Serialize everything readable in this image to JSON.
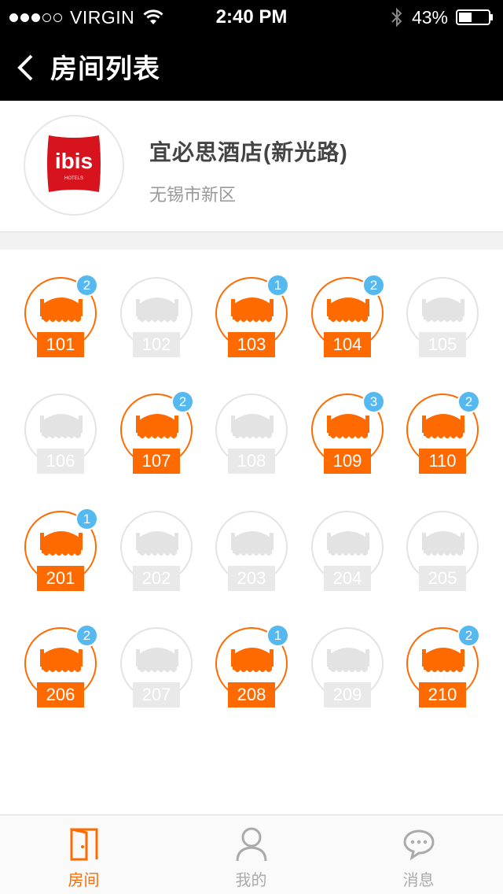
{
  "status_bar": {
    "carrier": "VIRGIN",
    "time": "2:40 PM",
    "battery": "43%",
    "signal_bars": 3,
    "signal_total": 5
  },
  "header": {
    "title": "房间列表"
  },
  "hotel": {
    "logo_text": "ibis",
    "logo_subtext": "HOTELS",
    "name": "宜必思酒店(新光路)",
    "area": "无锡市新区"
  },
  "colors": {
    "accent": "#ff6a00",
    "inactive": "#e3e3e3",
    "badge": "#55b8ef",
    "bar": "#000000"
  },
  "rooms": [
    {
      "number": "101",
      "occupied": true,
      "badge": "2"
    },
    {
      "number": "102",
      "occupied": false,
      "badge": ""
    },
    {
      "number": "103",
      "occupied": true,
      "badge": "1"
    },
    {
      "number": "104",
      "occupied": true,
      "badge": "2"
    },
    {
      "number": "105",
      "occupied": false,
      "badge": ""
    },
    {
      "number": "106",
      "occupied": false,
      "badge": ""
    },
    {
      "number": "107",
      "occupied": true,
      "badge": "2"
    },
    {
      "number": "108",
      "occupied": false,
      "badge": ""
    },
    {
      "number": "109",
      "occupied": true,
      "badge": "3"
    },
    {
      "number": "110",
      "occupied": true,
      "badge": "2"
    },
    {
      "number": "201",
      "occupied": true,
      "badge": "1"
    },
    {
      "number": "202",
      "occupied": false,
      "badge": ""
    },
    {
      "number": "203",
      "occupied": false,
      "badge": ""
    },
    {
      "number": "204",
      "occupied": false,
      "badge": ""
    },
    {
      "number": "205",
      "occupied": false,
      "badge": ""
    },
    {
      "number": "206",
      "occupied": true,
      "badge": "2"
    },
    {
      "number": "207",
      "occupied": false,
      "badge": ""
    },
    {
      "number": "208",
      "occupied": true,
      "badge": "1"
    },
    {
      "number": "209",
      "occupied": false,
      "badge": ""
    },
    {
      "number": "210",
      "occupied": true,
      "badge": "2"
    }
  ],
  "tabs": [
    {
      "label": "房间",
      "icon": "door-icon",
      "active": true
    },
    {
      "label": "我的",
      "icon": "user-icon",
      "active": false
    },
    {
      "label": "消息",
      "icon": "chat-bubble-icon",
      "active": false
    }
  ]
}
